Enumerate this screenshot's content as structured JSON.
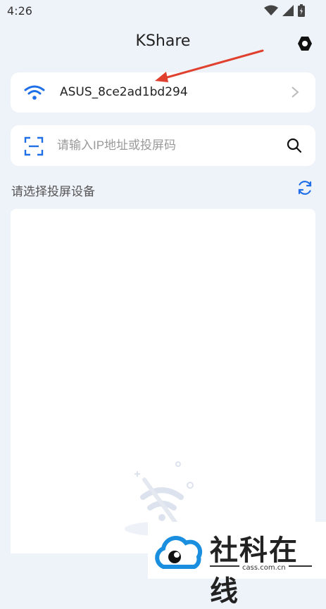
{
  "status_bar": {
    "time": "4:26"
  },
  "app": {
    "title": "KShare"
  },
  "wifi": {
    "ssid": "ASUS_8ce2ad1bd294"
  },
  "search": {
    "placeholder": "请输入IP地址或投屏码"
  },
  "device_list": {
    "label": "请选择投屏设备"
  },
  "watermark": {
    "text": "社科在线",
    "sub": "cass.com.cn"
  },
  "colors": {
    "accent": "#1f6fe8",
    "background": "#eef2f9",
    "arrow": "#e0412f"
  }
}
